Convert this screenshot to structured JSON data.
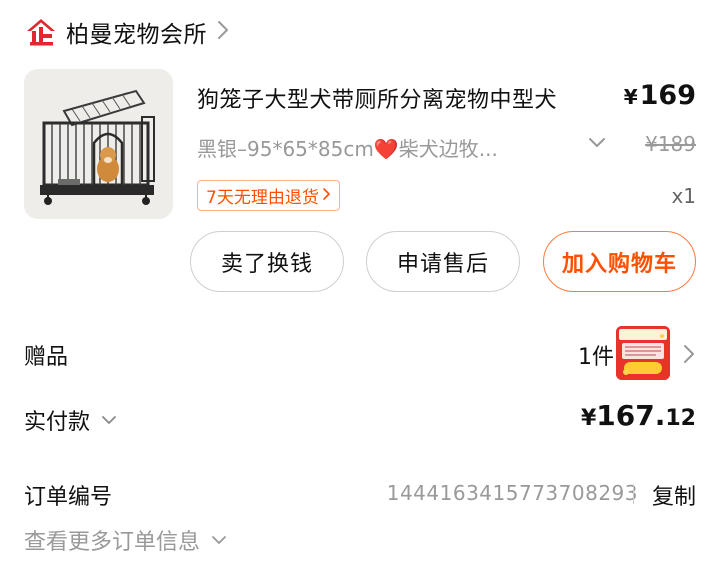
{
  "shop": {
    "name": "柏曼宠物会所",
    "logo_icon": "tmall-shop-logo-icon",
    "brand_color": "#e4262e"
  },
  "product": {
    "title": "狗笼子大型犬带厕所分离宠物中型犬",
    "currency": "¥",
    "price": "169",
    "sku": "黑银–95*65*85cm❤️柴犬边牧...",
    "original_price": "¥189",
    "return_policy": "7天无理由退货",
    "quantity": "x1",
    "image_icon": "dog-cage-product-image"
  },
  "actions": {
    "sell": "卖了换钱",
    "after_sales": "申请售后",
    "add_to_cart": "加入购物车",
    "accent_color": "#ff5000"
  },
  "gift": {
    "label": "赠品",
    "count": "1件",
    "thumb_text": "征集买家秀",
    "thumb_sub": "返现3元"
  },
  "payment": {
    "label": "实付款",
    "currency": "¥",
    "amount_int": "167.",
    "amount_dec": "12"
  },
  "order": {
    "label": "订单编号",
    "number": "1444163415773708293",
    "copy": "复制",
    "more": "查看更多订单信息"
  }
}
